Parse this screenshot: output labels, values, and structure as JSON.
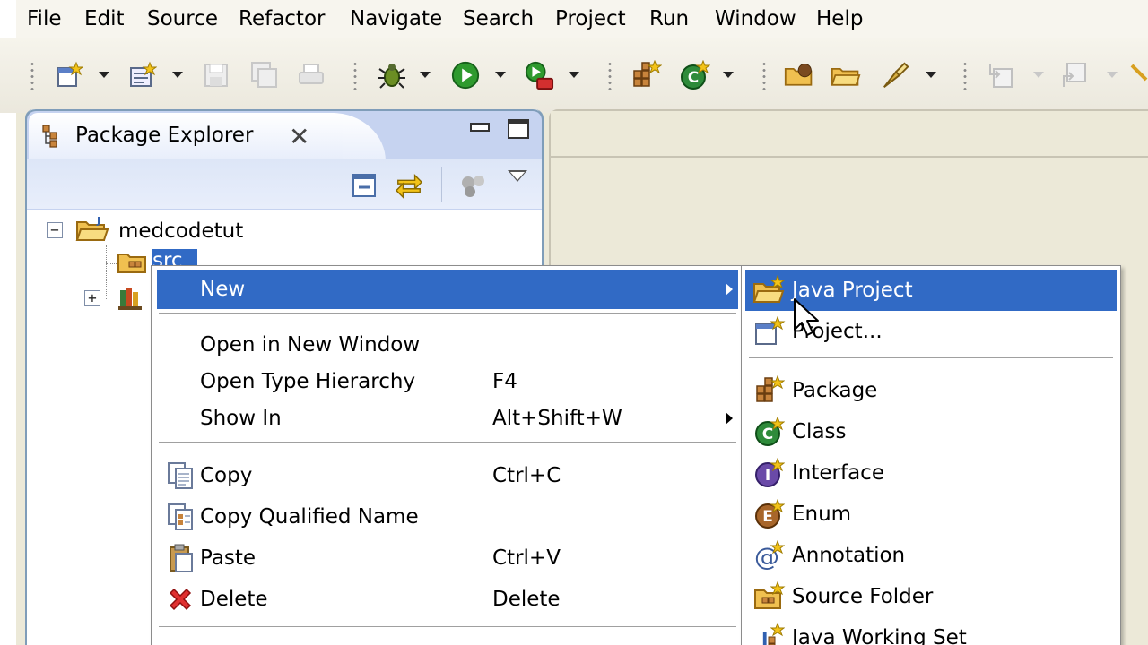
{
  "menubar": {
    "items": [
      "File",
      "Edit",
      "Source",
      "Refactor",
      "Navigate",
      "Search",
      "Project",
      "Run",
      "Window",
      "Help"
    ]
  },
  "toolbar": {
    "icons": [
      "new-wizard-icon",
      "open-type-icon",
      "save-icon",
      "save-all-icon",
      "print-icon",
      "debug-icon",
      "run-icon",
      "external-tools-icon",
      "new-package-icon",
      "new-class-icon",
      "open-folder-icon",
      "open-project-icon",
      "search-tool-icon",
      "next-annotation-icon",
      "previous-annotation-icon"
    ]
  },
  "package_explorer": {
    "tab_title": "Package Explorer",
    "tree": {
      "project": "medcodetut",
      "src_label": "src"
    }
  },
  "context_menu": {
    "items": [
      {
        "label": "New",
        "accel": "",
        "submenu": true,
        "highlighted": true
      },
      {
        "label": "Open in New Window",
        "accel": ""
      },
      {
        "label": "Open Type Hierarchy",
        "accel": "F4"
      },
      {
        "label": "Show In",
        "accel": "Alt+Shift+W",
        "submenu": true
      },
      {
        "label": "Copy",
        "accel": "Ctrl+C"
      },
      {
        "label": "Copy Qualified Name",
        "accel": ""
      },
      {
        "label": "Paste",
        "accel": "Ctrl+V"
      },
      {
        "label": "Delete",
        "accel": "Delete"
      }
    ]
  },
  "new_submenu": {
    "items": [
      {
        "label": "Java Project",
        "highlighted": true
      },
      {
        "label": "Project..."
      },
      {
        "label": "Package"
      },
      {
        "label": "Class"
      },
      {
        "label": "Interface"
      },
      {
        "label": "Enum"
      },
      {
        "label": "Annotation"
      },
      {
        "label": "Source Folder"
      },
      {
        "label": "Java Working Set"
      }
    ]
  },
  "colors": {
    "selection": "#316ac5",
    "view_border": "#7f9db9",
    "tab_bar": "#c6d3f0",
    "chrome": "#ece9d8"
  }
}
